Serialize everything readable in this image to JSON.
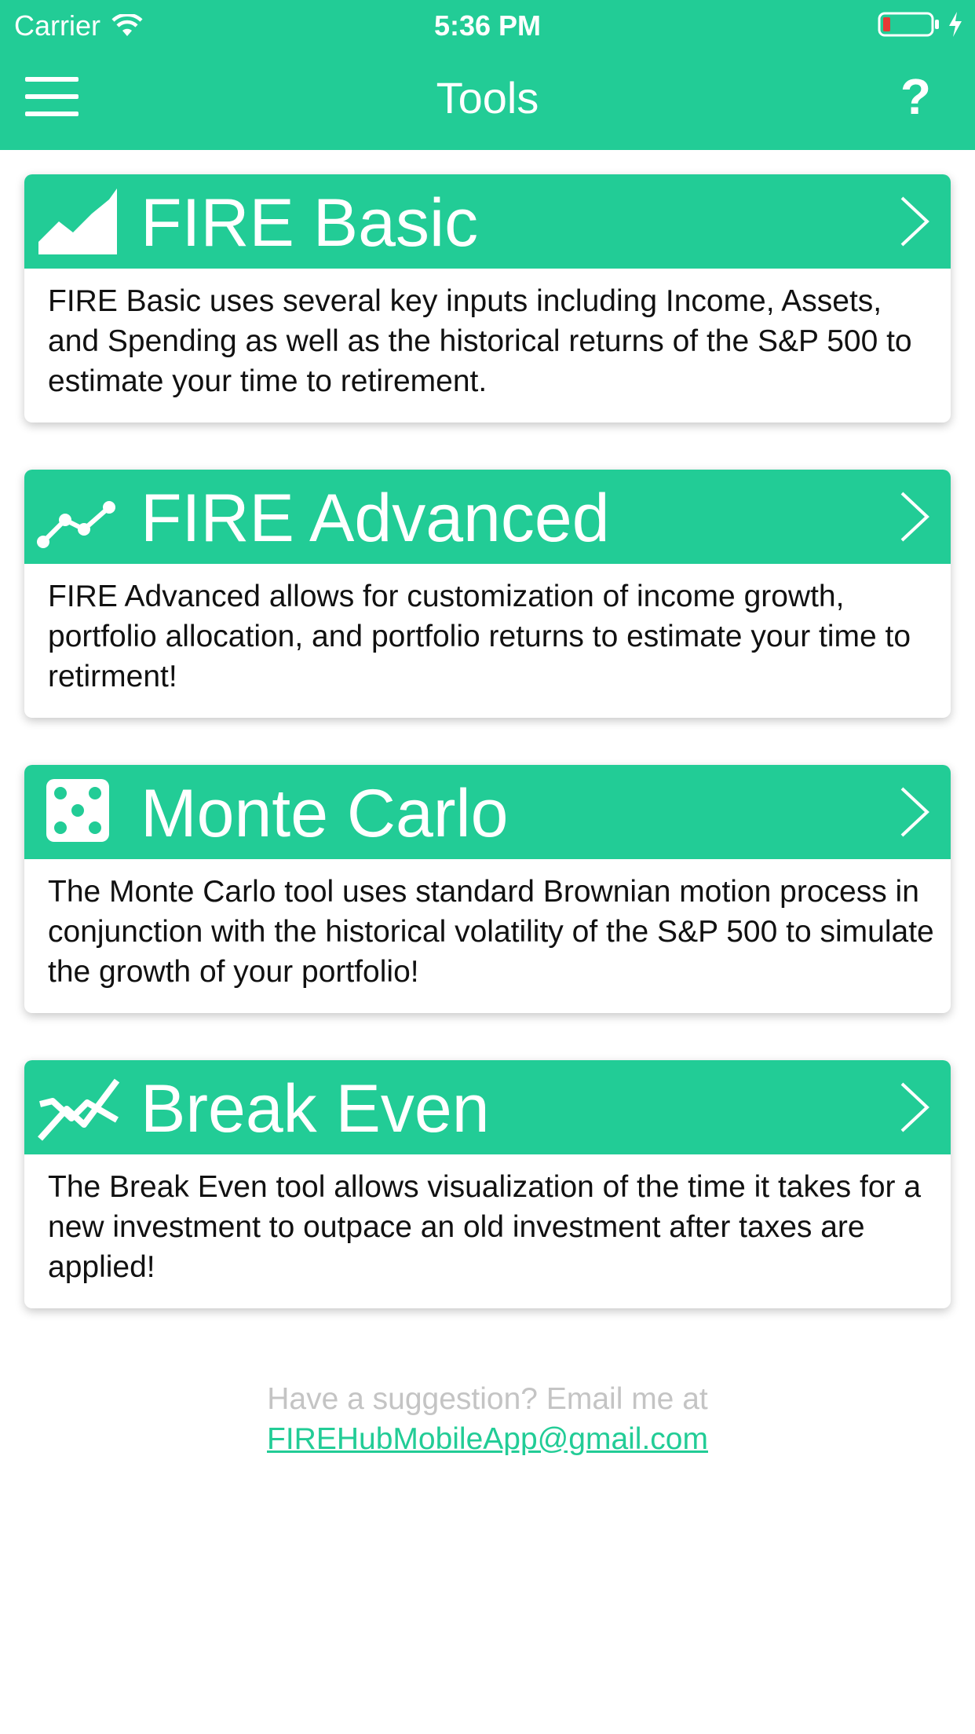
{
  "status_bar": {
    "carrier": "Carrier",
    "time": "5:36 PM"
  },
  "nav": {
    "title": "Tools",
    "help_label": "?",
    "menu_icon": "hamburger-menu-icon"
  },
  "colors": {
    "accent": "#22cc96",
    "card_text": "#111111",
    "footer_text": "#c4c4c4",
    "battery_low": "#e53935"
  },
  "tools": [
    {
      "title": "FIRE Basic",
      "icon": "area-chart-icon",
      "description": "FIRE Basic uses several key inputs including Income, Assets, and Spending as well as the historical returns of the S&P 500 to estimate your time to retirement."
    },
    {
      "title": "FIRE Advanced",
      "icon": "line-chart-icon",
      "description": "FIRE Advanced allows for customization of income growth, portfolio allocation, and portfolio returns to estimate your time to retirment!"
    },
    {
      "title": "Monte Carlo",
      "icon": "dice-icon",
      "description": "The Monte Carlo tool uses standard Brownian motion process in conjunction with the historical volatility of the S&P 500 to simulate the growth of your portfolio!"
    },
    {
      "title": "Break Even",
      "icon": "crossing-lines-icon",
      "description": "The Break Even tool allows visualization of the time it takes for a new investment to outpace an old investment after taxes are applied!"
    }
  ],
  "footer": {
    "text": "Have a suggestion? Email me at",
    "email": "FIREHubMobileApp@gmail.com"
  }
}
